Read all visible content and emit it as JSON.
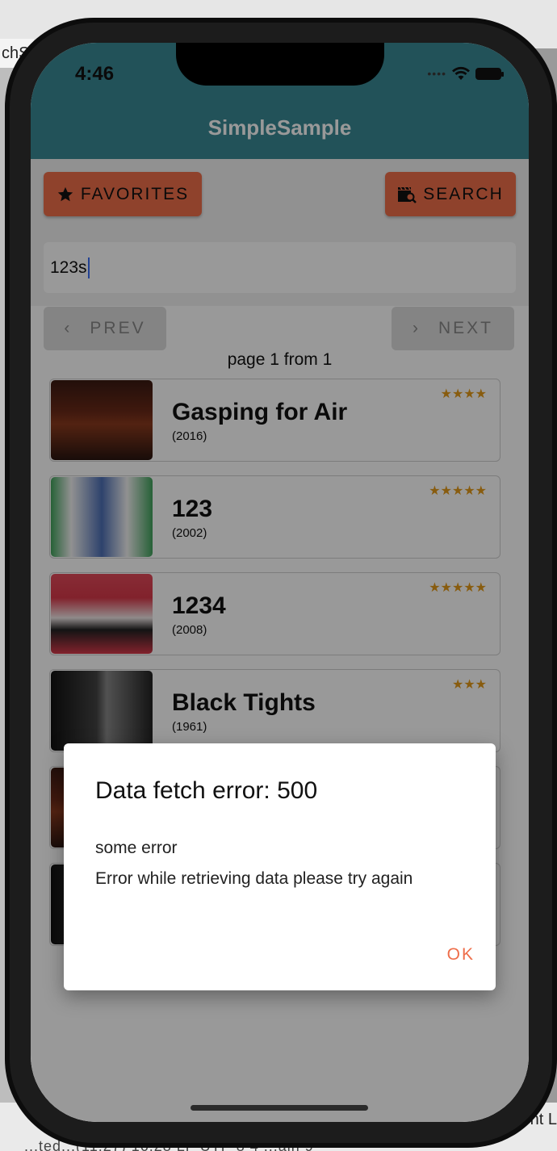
{
  "desktop": {
    "left_fragment": "chS",
    "bottom_right_fragment": "nt L",
    "bottom_status_fragment": "  ...ted...(11:27)          16:28    LF    UTF-8    4   ...ain 9"
  },
  "status_bar": {
    "time": "4:46"
  },
  "app": {
    "title": "SimpleSample"
  },
  "toolbar": {
    "favorites_label": "FAVORITES",
    "search_label": "SEARCH",
    "search_value": "123s"
  },
  "pager": {
    "prev_label": "PREV",
    "next_label": "NEXT",
    "page_info": "page 1 from 1"
  },
  "movies": [
    {
      "title": "Gasping for Air",
      "year": "(2016)",
      "rating": 4
    },
    {
      "title": "123",
      "year": "(2002)",
      "rating": 5
    },
    {
      "title": "1234",
      "year": "(2008)",
      "rating": 5
    },
    {
      "title": "Black Tights",
      "year": "(1961)",
      "rating": 3
    }
  ],
  "dialog": {
    "title": "Data fetch error: 500",
    "line1": "some error",
    "line2": "Error while retrieving data please try again",
    "ok_label": "OK"
  },
  "colors": {
    "header": "#3a8994",
    "accent": "#ee6e4a",
    "star": "#e39a1a"
  }
}
